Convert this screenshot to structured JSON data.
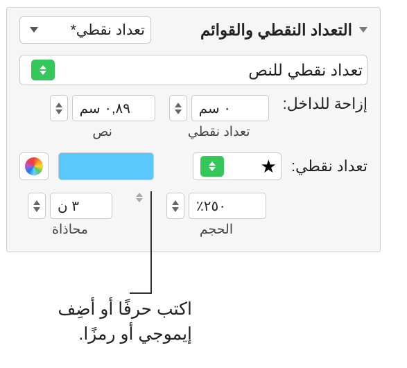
{
  "header": {
    "title": "التعداد النقطي والقوائم",
    "style_dropdown": "تعداد نقطي*"
  },
  "bullets_text_field": "تعداد نقطي للنص",
  "indent": {
    "label": "إزاحة للداخل:",
    "bullet_value": "٠ سم",
    "bullet_caption": "تعداد نقطي",
    "text_value": "٠,٨٩ سم",
    "text_caption": "نص"
  },
  "bullet_char": {
    "label": "تعداد نقطي:",
    "value": "★"
  },
  "size": {
    "value": "٢٥٠٪",
    "caption": "الحجم"
  },
  "align": {
    "value": "٣ ن",
    "caption": "محاذاة"
  },
  "callout": "اكتب حرفًا أو أضِف إيموجي أو رمزًا."
}
